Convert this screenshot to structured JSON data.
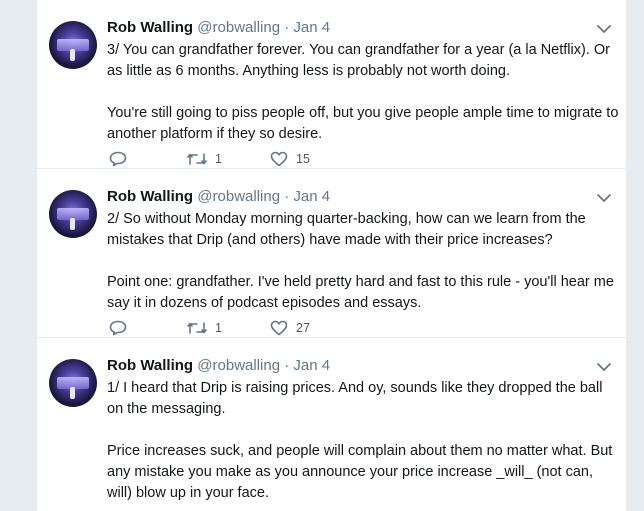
{
  "tweets": [
    {
      "name": "Rob Walling",
      "handle": "@robwalling",
      "separator": "·",
      "time": "Jan 4",
      "paragraphs": [
        "3/ You can grandfather forever. You can grandfather for a year (a la Netflix). Or as little as 6 months. Anything less is probably not worth doing.",
        "You're still going to piss people off, but you give people ample time to migrate to another platform if they so desire."
      ],
      "retweets": "1",
      "likes": "15"
    },
    {
      "name": "Rob Walling",
      "handle": "@robwalling",
      "separator": "·",
      "time": "Jan 4",
      "paragraphs": [
        "2/ So without Monday morning quarter-backing, how can we learn from the mistakes that Drip (and others) have made with their price increases?",
        "Point one: grandfather. I've held pretty hard and fast to this rule - you'll hear me say it in dozens of podcast episodes and essays."
      ],
      "retweets": "1",
      "likes": "27"
    },
    {
      "name": "Rob Walling",
      "handle": "@robwalling",
      "separator": "·",
      "time": "Jan 4",
      "paragraphs": [
        "1/ I heard that Drip is raising prices. And oy, sounds like they dropped the ball on the messaging.",
        "Price increases suck, and people will complain about them no matter what. But any mistake you make as you announce your price increase _will_ (not can, will) blow up in your face."
      ],
      "retweets": "",
      "likes": ""
    }
  ],
  "icons": {
    "chevron": "chevron-down-icon",
    "reply": "reply-icon",
    "retweet": "retweet-icon",
    "like": "heart-icon"
  },
  "colors": {
    "background": "#e6ecf0",
    "card": "#ffffff",
    "text": "#14171a",
    "muted": "#657786"
  }
}
